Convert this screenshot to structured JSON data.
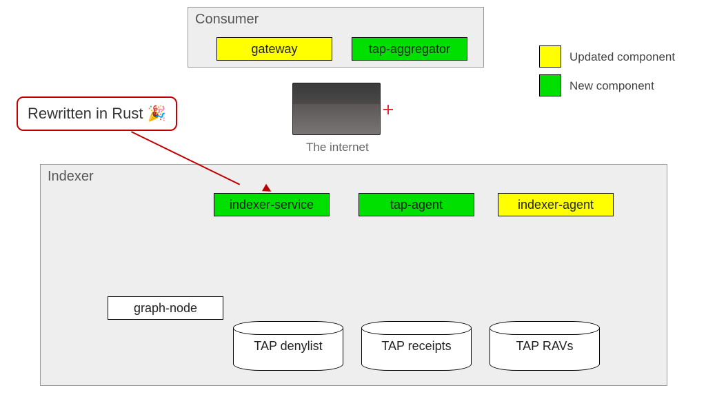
{
  "consumer": {
    "title": "Consumer",
    "gateway": "gateway",
    "tap_aggregator": "tap-aggregator"
  },
  "callout": {
    "text": "Rewritten in Rust 🎉"
  },
  "internet": {
    "caption": "The internet"
  },
  "indexer": {
    "title": "Indexer",
    "indexer_service": "indexer-service",
    "tap_agent": "tap-agent",
    "indexer_agent": "indexer-agent",
    "graph_node": "graph-node",
    "cyl1": "TAP denylist",
    "cyl2": "TAP receipts",
    "cyl3": "TAP RAVs"
  },
  "legend": {
    "updated": "Updated component",
    "new": "New component"
  },
  "colors": {
    "updated": "#ffff00",
    "new": "#00e000",
    "group_bg": "#eeeeee",
    "callout_border": "#c00000"
  }
}
